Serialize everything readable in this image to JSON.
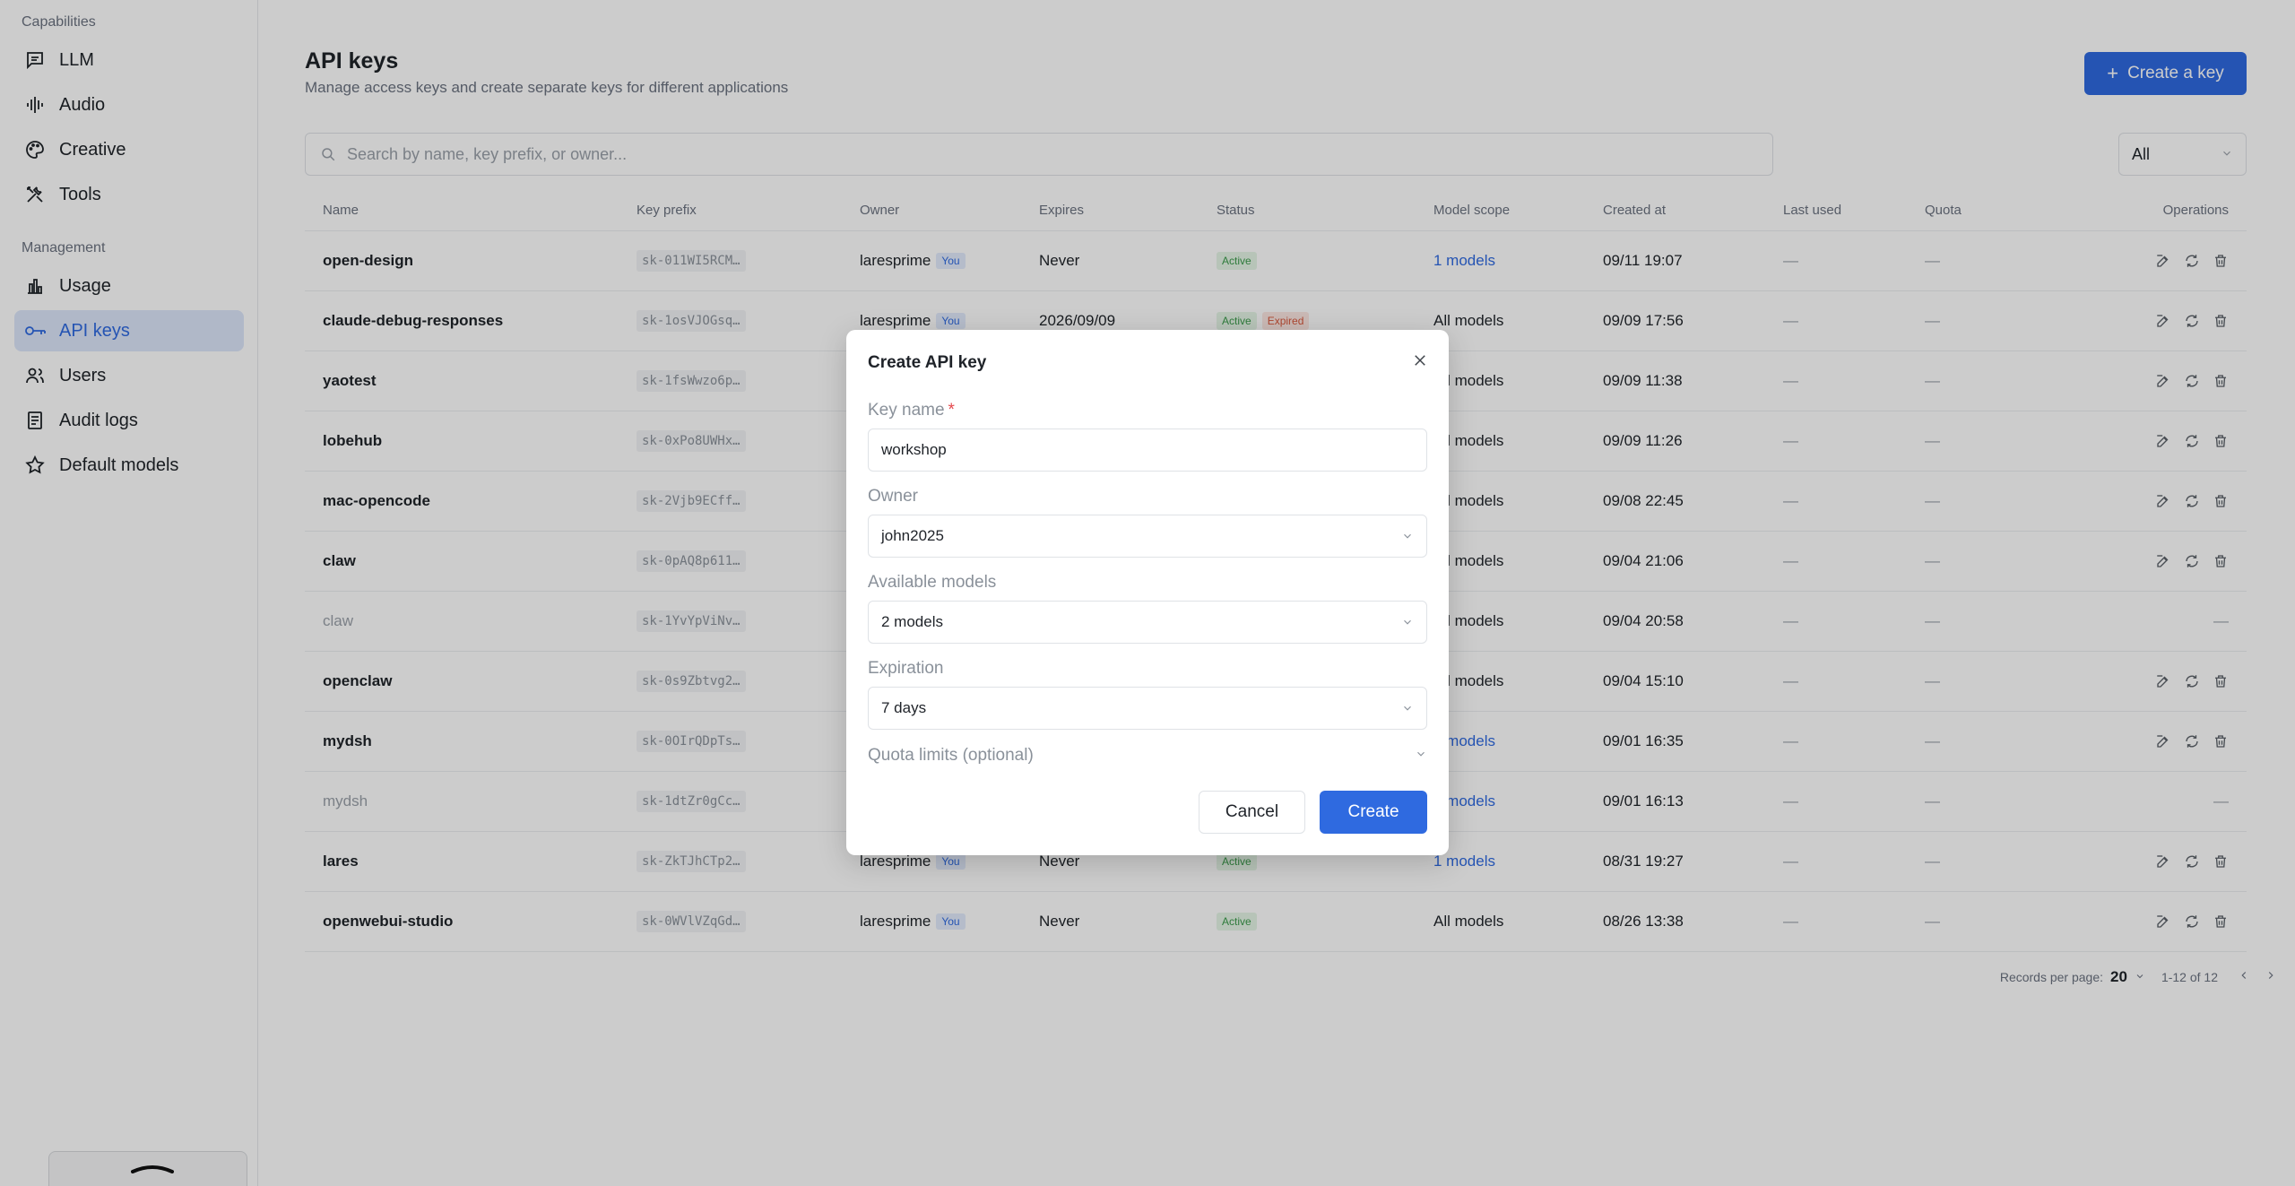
{
  "sidebar": {
    "capabilities_label": "Capabilities",
    "management_label": "Management",
    "items": [
      {
        "label": "LLM",
        "icon": "chat-icon"
      },
      {
        "label": "Audio",
        "icon": "waveform-icon"
      },
      {
        "label": "Creative",
        "icon": "palette-icon"
      },
      {
        "label": "Tools",
        "icon": "tools-icon"
      },
      {
        "label": "Usage",
        "icon": "bar-chart-icon"
      },
      {
        "label": "API keys",
        "icon": "key-icon"
      },
      {
        "label": "Users",
        "icon": "users-icon"
      },
      {
        "label": "Audit logs",
        "icon": "document-icon"
      },
      {
        "label": "Default models",
        "icon": "star-icon"
      }
    ],
    "active": "API keys"
  },
  "header": {
    "title": "API keys",
    "subtitle": "Manage access keys and create separate keys for different applications",
    "create_button": "Create a key"
  },
  "search": {
    "placeholder": "Search by name, key prefix, or owner..."
  },
  "filter": {
    "value": "All"
  },
  "table": {
    "columns": [
      "Name",
      "Key prefix",
      "Owner",
      "Expires",
      "Status",
      "Model scope",
      "Created at",
      "Last used",
      "Quota",
      "Operations"
    ],
    "rows": [
      {
        "name": "open-design",
        "prefix": "sk-011WI5RCM…",
        "owner": "laresprime",
        "you": "You",
        "expires": "Never",
        "status": [
          "Active"
        ],
        "scope": "1 models",
        "created": "09/11 19:07",
        "last": "—",
        "quota": "—",
        "disabled": false
      },
      {
        "name": "claude-debug-responses",
        "prefix": "sk-1osVJOGsq…",
        "owner": "laresprime",
        "you": "You",
        "expires": "2026/09/09",
        "status": [
          "Active",
          "Expired"
        ],
        "scope": "All models",
        "created": "09/09 17:56",
        "last": "—",
        "quota": "—",
        "disabled": false
      },
      {
        "name": "yaotest",
        "prefix": "sk-1fsWwzo6p…",
        "owner": "",
        "you": "",
        "expires": "",
        "status": [],
        "scope": "All models",
        "created": "09/09 11:38",
        "last": "—",
        "quota": "—",
        "disabled": false
      },
      {
        "name": "lobehub",
        "prefix": "sk-0xPo8UWHx…",
        "owner": "",
        "you": "",
        "expires": "",
        "status": [],
        "scope": "All models",
        "created": "09/09 11:26",
        "last": "—",
        "quota": "—",
        "disabled": false
      },
      {
        "name": "mac-opencode",
        "prefix": "sk-2Vjb9ECff…",
        "owner": "",
        "you": "",
        "expires": "",
        "status": [],
        "scope": "All models",
        "created": "09/08 22:45",
        "last": "—",
        "quota": "—",
        "disabled": false
      },
      {
        "name": "claw",
        "prefix": "sk-0pAQ8p611…",
        "owner": "",
        "you": "",
        "expires": "",
        "status": [],
        "scope": "All models",
        "created": "09/04 21:06",
        "last": "—",
        "quota": "—",
        "disabled": false
      },
      {
        "name": "claw",
        "prefix": "sk-1YvYpViNv…",
        "owner": "",
        "you": "",
        "expires": "",
        "status": [],
        "scope": "All models",
        "created": "09/04 20:58",
        "last": "—",
        "quota": "—",
        "disabled": true
      },
      {
        "name": "openclaw",
        "prefix": "sk-0s9Zbtvg2…",
        "owner": "",
        "you": "",
        "expires": "",
        "status": [],
        "scope": "All models",
        "created": "09/04 15:10",
        "last": "—",
        "quota": "—",
        "disabled": false
      },
      {
        "name": "mydsh",
        "prefix": "sk-0OIrQDpTs…",
        "owner": "",
        "you": "",
        "expires": "",
        "status": [],
        "scope": "1 models",
        "created": "09/01 16:35",
        "last": "—",
        "quota": "—",
        "disabled": false
      },
      {
        "name": "mydsh",
        "prefix": "sk-1dtZr0gCc…",
        "owner": "",
        "you": "",
        "expires": "",
        "status": [],
        "scope": "1 models",
        "created": "09/01 16:13",
        "last": "—",
        "quota": "—",
        "disabled": true
      },
      {
        "name": "lares",
        "prefix": "sk-ZkTJhCTp2…",
        "owner": "laresprime",
        "you": "You",
        "expires": "Never",
        "status": [
          "Active"
        ],
        "scope": "1 models",
        "created": "08/31 19:27",
        "last": "—",
        "quota": "—",
        "disabled": false
      },
      {
        "name": "openwebui-studio",
        "prefix": "sk-0WVlVZqGd…",
        "owner": "laresprime",
        "you": "You",
        "expires": "Never",
        "status": [
          "Active"
        ],
        "scope": "All models",
        "created": "08/26 13:38",
        "last": "—",
        "quota": "—",
        "disabled": false
      }
    ]
  },
  "pager": {
    "label": "Records per page:",
    "size": "20",
    "range": "1-12 of 12"
  },
  "modal": {
    "title": "Create API key",
    "key_name_label": "Key name",
    "required_mark": "*",
    "key_name_value": "workshop",
    "owner_label": "Owner",
    "owner_value": "john2025",
    "models_label": "Available models",
    "models_value": "2 models",
    "expiration_label": "Expiration",
    "expiration_value": "7 days",
    "quota_label": "Quota limits (optional)",
    "cancel": "Cancel",
    "create": "Create"
  },
  "colors": {
    "accent": "#2f6ae0",
    "active_badge": "#3a9a4a",
    "expired_badge": "#d9583c"
  }
}
